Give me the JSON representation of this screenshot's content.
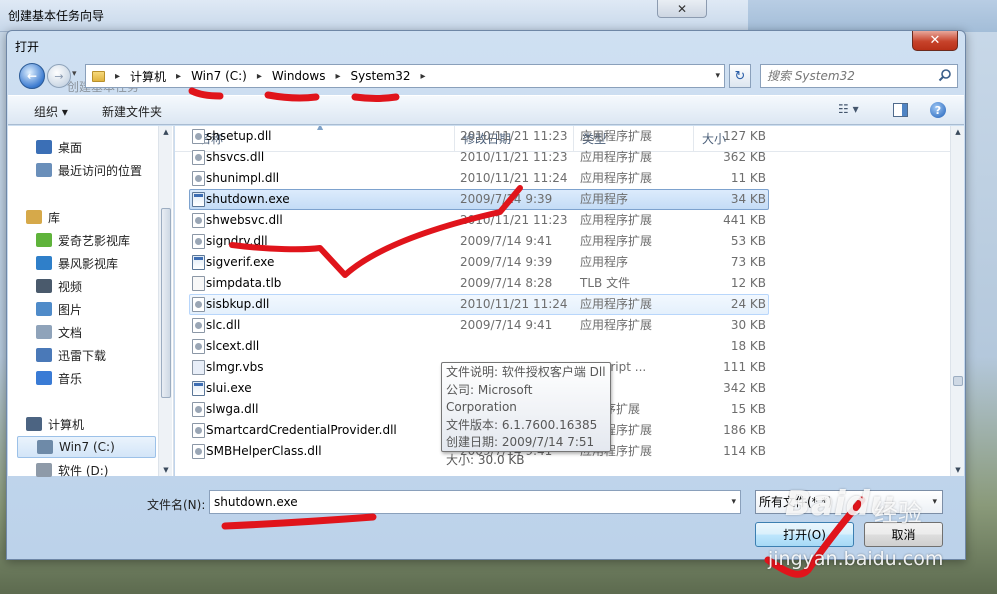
{
  "background_window": {
    "title": "创建基本任务向导",
    "close_glyph": "✕",
    "faded_text": "创建基本任务"
  },
  "dialog": {
    "title": "打开",
    "close_glyph": "✕"
  },
  "address_bar": {
    "crumbs": [
      "计算机",
      "Win7 (C:)",
      "Windows",
      "System32"
    ],
    "separator": "▸",
    "dropdown_glyph": "▾"
  },
  "refresh_glyph": "↻",
  "search": {
    "placeholder": "搜索 System32"
  },
  "toolbar": {
    "organize_label": "组织 ▾",
    "new_folder_label": "新建文件夹",
    "view_label": "☷ ▾",
    "help_label": "?"
  },
  "nav_pane": {
    "items": [
      {
        "label": "桌面",
        "icon": "desktop-icon",
        "color": "#3b6fb6"
      },
      {
        "label": "最近访问的位置",
        "icon": "recent-places-icon",
        "color": "#6a8fba"
      },
      {
        "label": "库",
        "icon": "libraries-icon",
        "color": "#d6a94a"
      },
      {
        "label": "爱奇艺影视库",
        "icon": "iqiyi-icon",
        "color": "#5fb33b"
      },
      {
        "label": "暴风影视库",
        "icon": "baofeng-icon",
        "color": "#2f7fc9"
      },
      {
        "label": "视频",
        "icon": "video-icon",
        "color": "#4a5a6c"
      },
      {
        "label": "图片",
        "icon": "pictures-icon",
        "color": "#4f8bc9"
      },
      {
        "label": "文档",
        "icon": "documents-icon",
        "color": "#8fa3ba"
      },
      {
        "label": "迅雷下载",
        "icon": "xunlei-icon",
        "color": "#4a79b8"
      },
      {
        "label": "音乐",
        "icon": "music-icon",
        "color": "#3a7bd5"
      },
      {
        "label": "计算机",
        "icon": "computer-icon",
        "color": "#4c6482"
      },
      {
        "label": "Win7 (C:)",
        "icon": "drive-c-icon",
        "color": "#6e8aa8"
      },
      {
        "label": "软件 (D:)",
        "icon": "drive-d-icon",
        "color": "#8e9aa8"
      }
    ]
  },
  "columns": {
    "name": "名称",
    "date": "修改日期",
    "type": "类型",
    "size": "大小"
  },
  "files": [
    {
      "name": "shsetup.dll",
      "date": "2010/11/21 11:23",
      "type": "应用程序扩展",
      "size": "127 KB",
      "kind": "dll"
    },
    {
      "name": "shsvcs.dll",
      "date": "2010/11/21 11:23",
      "type": "应用程序扩展",
      "size": "362 KB",
      "kind": "dll"
    },
    {
      "name": "shunimpl.dll",
      "date": "2010/11/21 11:24",
      "type": "应用程序扩展",
      "size": "11 KB",
      "kind": "dll"
    },
    {
      "name": "shutdown.exe",
      "date": "2009/7/14 9:39",
      "type": "应用程序",
      "size": "34 KB",
      "kind": "exe",
      "state": "selected"
    },
    {
      "name": "shwebsvc.dll",
      "date": "2010/11/21 11:23",
      "type": "应用程序扩展",
      "size": "441 KB",
      "kind": "dll"
    },
    {
      "name": "signdrv.dll",
      "date": "2009/7/14 9:41",
      "type": "应用程序扩展",
      "size": "53 KB",
      "kind": "dll"
    },
    {
      "name": "sigverif.exe",
      "date": "2009/7/14 9:39",
      "type": "应用程序",
      "size": "73 KB",
      "kind": "exe"
    },
    {
      "name": "simpdata.tlb",
      "date": "2009/7/14 8:28",
      "type": "TLB 文件",
      "size": "12 KB",
      "kind": "tlb"
    },
    {
      "name": "sisbkup.dll",
      "date": "2010/11/21 11:24",
      "type": "应用程序扩展",
      "size": "24 KB",
      "kind": "dll",
      "state": "hover"
    },
    {
      "name": "slc.dll",
      "date": "2009/7/14 9:41",
      "type": "应用程序扩展",
      "size": "30 KB",
      "kind": "dll"
    },
    {
      "name": "slcext.dll",
      "date": "",
      "type": "",
      "size": "18 KB",
      "kind": "dll"
    },
    {
      "name": "slmgr.vbs",
      "date": "",
      "type": "pt Script ...",
      "size": "111 KB",
      "kind": "vbs"
    },
    {
      "name": "slui.exe",
      "date": "",
      "type": "字",
      "size": "342 KB",
      "kind": "exe"
    },
    {
      "name": "slwga.dll",
      "date": "",
      "type": "用程序扩展",
      "size": "15 KB",
      "kind": "dll"
    },
    {
      "name": "SmartcardCredentialProvider.dll",
      "date": "2010/11/21 11:24",
      "type": "应用程序扩展",
      "size": "186 KB",
      "kind": "dll"
    },
    {
      "name": "SMBHelperClass.dll",
      "date": "2009/7/14 9:41",
      "type": "应用程序扩展",
      "size": "114 KB",
      "kind": "dll"
    }
  ],
  "tooltip": {
    "description": "文件说明: 软件授权客户端 Dll",
    "company": "公司: Microsoft Corporation",
    "version": "文件版本: 6.1.7600.16385",
    "created": "创建日期: 2009/7/14 7:51",
    "size": "大小: 30.0 KB"
  },
  "filename": {
    "label": "文件名(N):",
    "value": "shutdown.exe"
  },
  "file_type_filter": {
    "value": "所有文件(*.*)"
  },
  "buttons": {
    "open": "打开(O)",
    "cancel": "取消"
  },
  "watermark": {
    "brand": "Baidu",
    "brand_cn": "经验",
    "url": "jingyan.baidu.com"
  },
  "colors": {
    "annotation_red": "#e0141b",
    "selection_blue": "#c4dcf6",
    "title_bar": "#cfe0f2"
  }
}
